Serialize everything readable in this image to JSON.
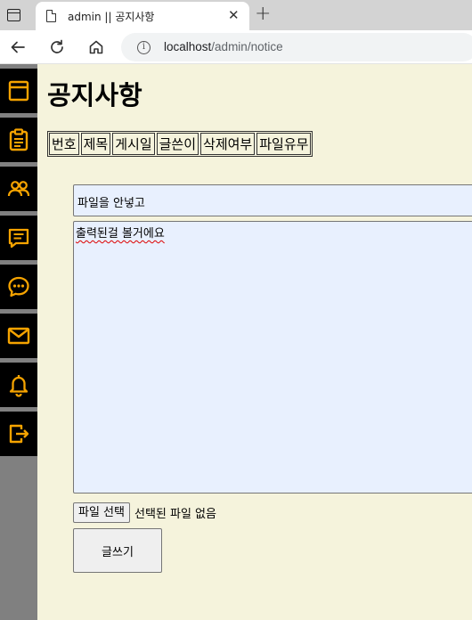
{
  "browser": {
    "tab_title": "admin || 공지사항",
    "tab_close": "✕",
    "new_tab": "+",
    "url_host": "localhost",
    "url_path": "/admin/notice",
    "info_glyph": "i"
  },
  "sidebar": {
    "accent_color": "#f5a300",
    "background": "#808080",
    "items": [
      {
        "icon": "window-icon"
      },
      {
        "icon": "clipboard-icon"
      },
      {
        "icon": "users-icon"
      },
      {
        "icon": "message-square-icon"
      },
      {
        "icon": "chat-bubble-icon"
      },
      {
        "icon": "mail-icon"
      },
      {
        "icon": "bell-icon"
      },
      {
        "icon": "logout-icon"
      }
    ]
  },
  "page": {
    "title": "공지사항",
    "background": "#f5f3dc"
  },
  "table": {
    "headers": [
      "번호",
      "제목",
      "게시일",
      "글쓴이",
      "삭제여부",
      "파일유무"
    ]
  },
  "form": {
    "title_value": "파일을 안넣고",
    "content_value": "출력된걸 볼거에요",
    "file_button_label": "파일 선택",
    "file_status": "선택된 파일 없음",
    "submit_label": "글쓰기"
  }
}
